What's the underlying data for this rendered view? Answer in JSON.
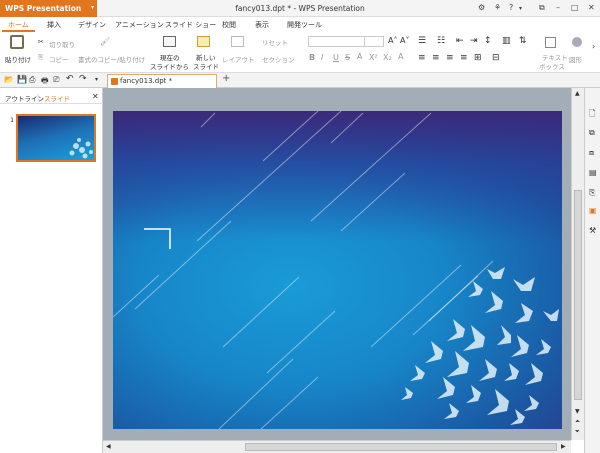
{
  "app": {
    "name": "WPS Presentation",
    "window_title": "fancy013.dpt * - WPS Presentation"
  },
  "tabs": [
    "ホーム",
    "挿入",
    "デザイン",
    "アニメーション",
    "スライド ショー",
    "校閲",
    "表示",
    "開発ツール"
  ],
  "ribbon": {
    "paste": "貼り付け",
    "cut": "切り取り",
    "copy": "コピー",
    "format_painter": "書式のコピー/貼り付け",
    "from_current_1": "現在の",
    "from_current_2": "スライドから",
    "new_slide_1": "新しい",
    "new_slide_2": "スライド",
    "layout": "レイアウト",
    "reset": "リセット",
    "section": "セクション",
    "textbox_1": "テキスト",
    "textbox_2": "ボックス",
    "shape": "図形",
    "font_bold": "B",
    "font_italic": "I",
    "font_underline": "U",
    "font_strike": "S"
  },
  "document_tab": "fancy013.dpt *",
  "left_pane": {
    "outline_tab": "アウトライン",
    "slides_tab": "スライド",
    "slide_number": "1"
  },
  "colors": {
    "accent": "#e2761f",
    "slide_dark": "#2a3b8a",
    "slide_light": "#1aa0de"
  }
}
